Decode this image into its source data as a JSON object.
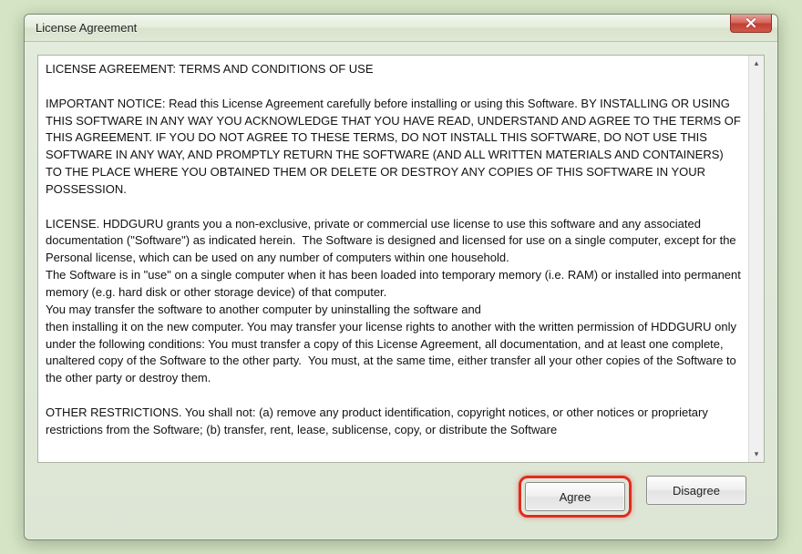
{
  "window": {
    "title": "License Agreement"
  },
  "license": {
    "heading": "LICENSE AGREEMENT: TERMS AND CONDITIONS OF USE",
    "body": "IMPORTANT NOTICE: Read this License Agreement carefully before installing or using this Software. BY INSTALLING OR USING THIS SOFTWARE IN ANY WAY YOU ACKNOWLEDGE THAT YOU HAVE READ, UNDERSTAND AND AGREE TO THE TERMS OF THIS AGREEMENT. IF YOU DO NOT AGREE TO THESE TERMS, DO NOT INSTALL THIS SOFTWARE, DO NOT USE THIS SOFTWARE IN ANY WAY, AND PROMPTLY RETURN THE SOFTWARE (AND ALL WRITTEN MATERIALS AND CONTAINERS) TO THE PLACE WHERE YOU OBTAINED THEM OR DELETE OR DESTROY ANY COPIES OF THIS SOFTWARE IN YOUR POSSESSION.\n\nLICENSE. HDDGURU grants you a non-exclusive, private or commercial use license to use this software and any associated\ndocumentation (\"Software\") as indicated herein.  The Software is designed and licensed for use on a single computer, except for the Personal license, which can be used on any number of computers within one household.\nThe Software is in \"use\" on a single computer when it has been loaded into temporary memory (i.e. RAM) or installed into permanent memory (e.g. hard disk or other storage device) of that computer.\nYou may transfer the software to another computer by uninstalling the software and\nthen installing it on the new computer. You may transfer your license rights to another with the written permission of HDDGURU only under the following conditions: You must transfer a copy of this License Agreement, all documentation, and at least one complete, unaltered copy of the Software to the other party.  You must, at the same time, either transfer all your other copies of the Software to the other party or destroy them.\n\nOTHER RESTRICTIONS. You shall not: (a) remove any product identification, copyright notices, or other notices or proprietary restrictions from the Software; (b) transfer, rent, lease, sublicense, copy, or distribute the Software"
  },
  "buttons": {
    "agree": "Agree",
    "disagree": "Disagree"
  }
}
